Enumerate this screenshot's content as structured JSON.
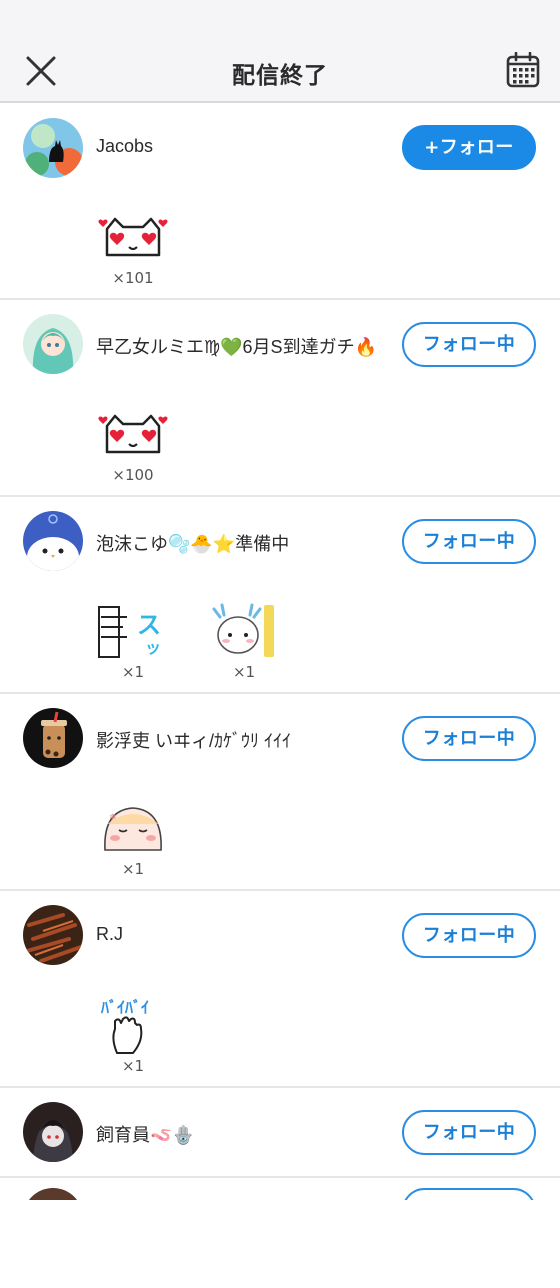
{
  "header": {
    "title": "配信終了",
    "close_icon": "close-icon",
    "calendar_icon": "calendar-icon"
  },
  "colors": {
    "accent": "#1a8ae6",
    "header_bg": "#f5f5f7",
    "divider": "#e6e6e8"
  },
  "users": [
    {
      "name": "Jacobs",
      "button": "+フォロー",
      "following": false,
      "stamps": [
        {
          "icon": "heart-eyes-cat-sticker",
          "count": "×101"
        }
      ]
    },
    {
      "name": "早乙女ルミエ♍💚6月S到達ガチ🔥",
      "button": "フォロー中",
      "following": true,
      "stamps": [
        {
          "icon": "heart-eyes-cat-sticker",
          "count": "×100"
        }
      ]
    },
    {
      "name": "泡沫こゆ🫧🐣⭐準備中",
      "button": "フォロー中",
      "following": true,
      "stamps": [
        {
          "icon": "sutsu-exit-sticker",
          "count": "×1"
        },
        {
          "icon": "dragon-character-sticker",
          "count": "×1"
        }
      ]
    },
    {
      "name": "影浮吏 いヰィ/ｶｹﾞｳﾘ ｲｲｲ",
      "button": "フォロー中",
      "following": true,
      "stamps": [
        {
          "icon": "sleepy-bun-sticker",
          "count": "×1"
        }
      ]
    },
    {
      "name": "R.J",
      "button": "フォロー中",
      "following": true,
      "stamps": [
        {
          "icon": "byebye-hand-sticker",
          "count": "×1"
        }
      ]
    },
    {
      "name": "飼育員🪱🪬",
      "button": "フォロー中",
      "following": true,
      "stamps": []
    }
  ]
}
